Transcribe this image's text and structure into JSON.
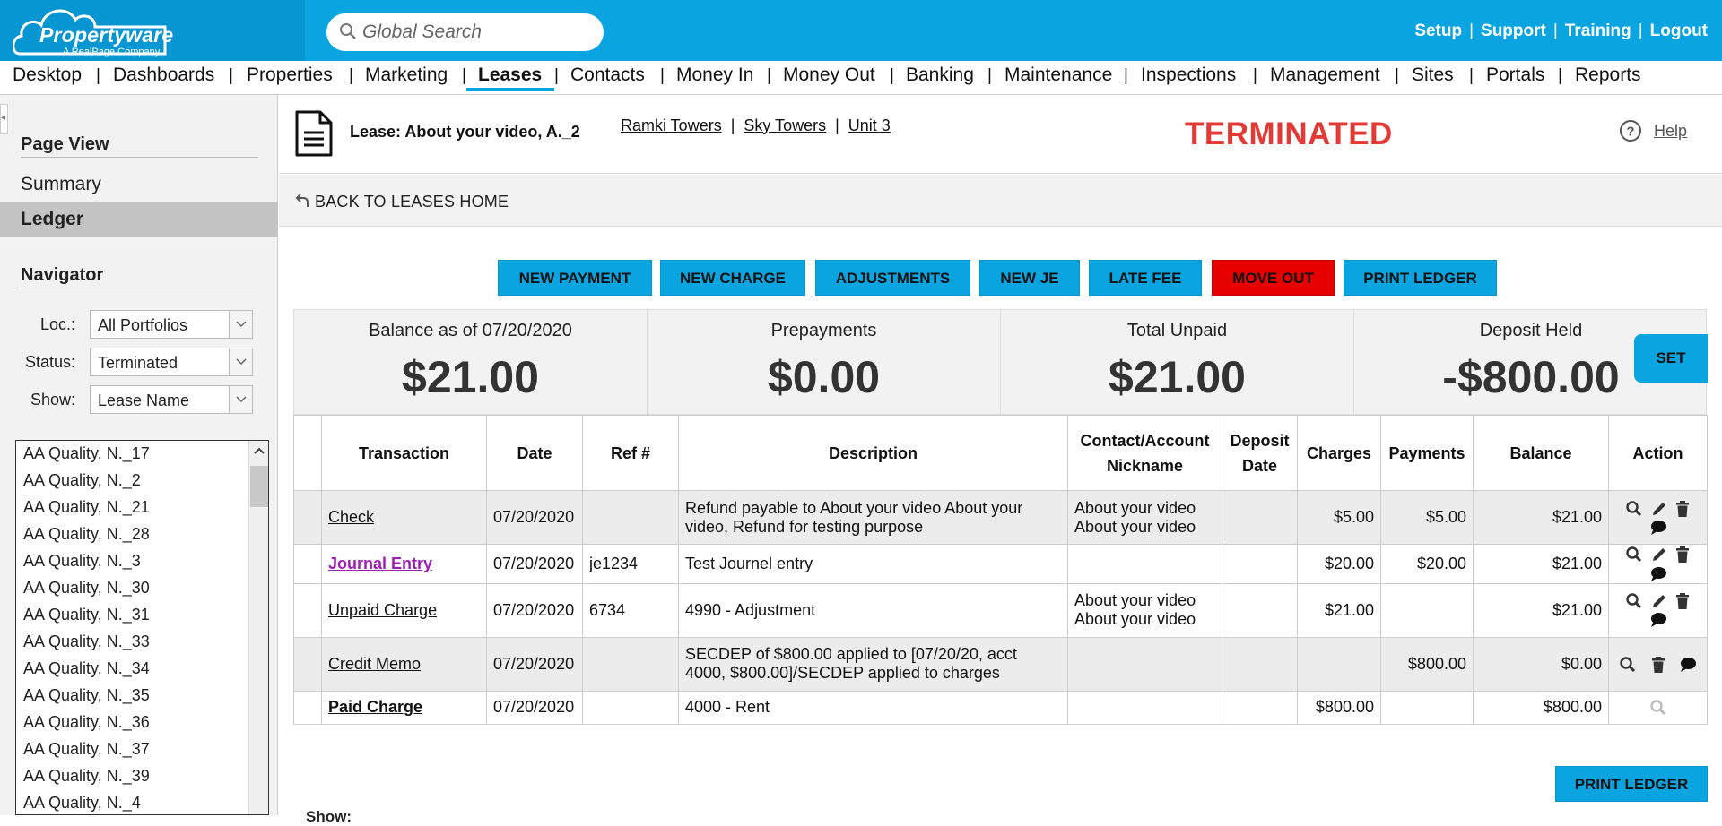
{
  "brand": {
    "name": "Propertyware",
    "tagline": "A RealPage Company"
  },
  "search": {
    "placeholder": "Global Search"
  },
  "top_links": [
    "Setup",
    "Support",
    "Training",
    "Logout"
  ],
  "nav": {
    "items": [
      "Desktop",
      "Dashboards",
      "Properties",
      "Marketing",
      "Leases",
      "Contacts",
      "Money In",
      "Money Out",
      "Banking",
      "Maintenance",
      "Inspections",
      "Management",
      "Sites",
      "Portals",
      "Reports"
    ],
    "active": "Leases"
  },
  "sidebar": {
    "page_view_title": "Page View",
    "page_view_items": [
      "Summary",
      "Ledger"
    ],
    "active_view": "Ledger",
    "navigator_title": "Navigator",
    "filters": [
      {
        "label": "Loc.:",
        "value": "All Portfolios"
      },
      {
        "label": "Status:",
        "value": "Terminated"
      },
      {
        "label": "Show:",
        "value": "Lease Name"
      }
    ],
    "lease_list": [
      "AA Quality, N._17",
      "AA Quality, N._2",
      "AA Quality, N._21",
      "AA Quality, N._28",
      "AA Quality, N._3",
      "AA Quality, N._30",
      "AA Quality, N._31",
      "AA Quality, N._33",
      "AA Quality, N._34",
      "AA Quality, N._35",
      "AA Quality, N._36",
      "AA Quality, N._37",
      "AA Quality, N._39",
      "AA Quality, N._4"
    ]
  },
  "lease": {
    "title": "Lease: About your video, A._2",
    "breadcrumbs": [
      "Ramki Towers",
      "Sky Towers",
      "Unit 3"
    ],
    "status": "TERMINATED",
    "help": "Help",
    "back": "BACK TO LEASES HOME"
  },
  "actions": [
    "NEW PAYMENT",
    "NEW CHARGE",
    "ADJUSTMENTS",
    "NEW JE",
    "LATE FEE",
    "MOVE OUT",
    "PRINT LEDGER"
  ],
  "summary": [
    {
      "label": "Balance as of 07/20/2020",
      "value": "$21.00"
    },
    {
      "label": "Prepayments",
      "value": "$0.00"
    },
    {
      "label": "Total Unpaid",
      "value": "$21.00"
    },
    {
      "label": "Deposit Held",
      "value": "-$800.00"
    }
  ],
  "set_button": "SET",
  "ledger": {
    "columns": [
      "Transaction",
      "Date",
      "Ref #",
      "Description",
      "Contact/Account Nickname",
      "Deposit Date",
      "Charges",
      "Payments",
      "Balance",
      "Action"
    ],
    "rows": [
      {
        "transaction": "Check",
        "date": "07/20/2020",
        "ref": "",
        "description": "Refund payable to About your video About your video, Refund for testing purpose",
        "contact": "About your video About your video",
        "deposit_date": "",
        "charges": "$5.00",
        "payments": "$5.00",
        "balance": "$21.00"
      },
      {
        "transaction": "Journal Entry",
        "date": "07/20/2020",
        "ref": "je1234",
        "description": "Test Journel entry",
        "contact": "",
        "deposit_date": "",
        "charges": "$20.00",
        "payments": "$20.00",
        "balance": "$21.00"
      },
      {
        "transaction": "Unpaid Charge",
        "date": "07/20/2020",
        "ref": "6734",
        "description": "4990 - Adjustment",
        "contact": "About your video About your video",
        "deposit_date": "",
        "charges": "$21.00",
        "payments": "",
        "balance": "$21.00"
      },
      {
        "transaction": "Credit Memo",
        "date": "07/20/2020",
        "ref": "",
        "description": "SECDEP of $800.00 applied to [07/20/20, acct 4000, $800.00]/SECDEP applied to charges",
        "contact": "",
        "deposit_date": "",
        "charges": "",
        "payments": "$800.00",
        "balance": "$0.00"
      },
      {
        "transaction": "Paid Charge",
        "date": "07/20/2020",
        "ref": "",
        "description": "4000 - Rent",
        "contact": "",
        "deposit_date": "",
        "charges": "$800.00",
        "payments": "",
        "balance": "$800.00"
      }
    ]
  },
  "bottom": {
    "print": "PRINT LEDGER",
    "show_label": "Show:"
  },
  "colors": {
    "brand_blue": "#0aa5e0",
    "danger": "#e60000",
    "status_red": "#e53935",
    "link_purple": "#9c1fb5"
  }
}
